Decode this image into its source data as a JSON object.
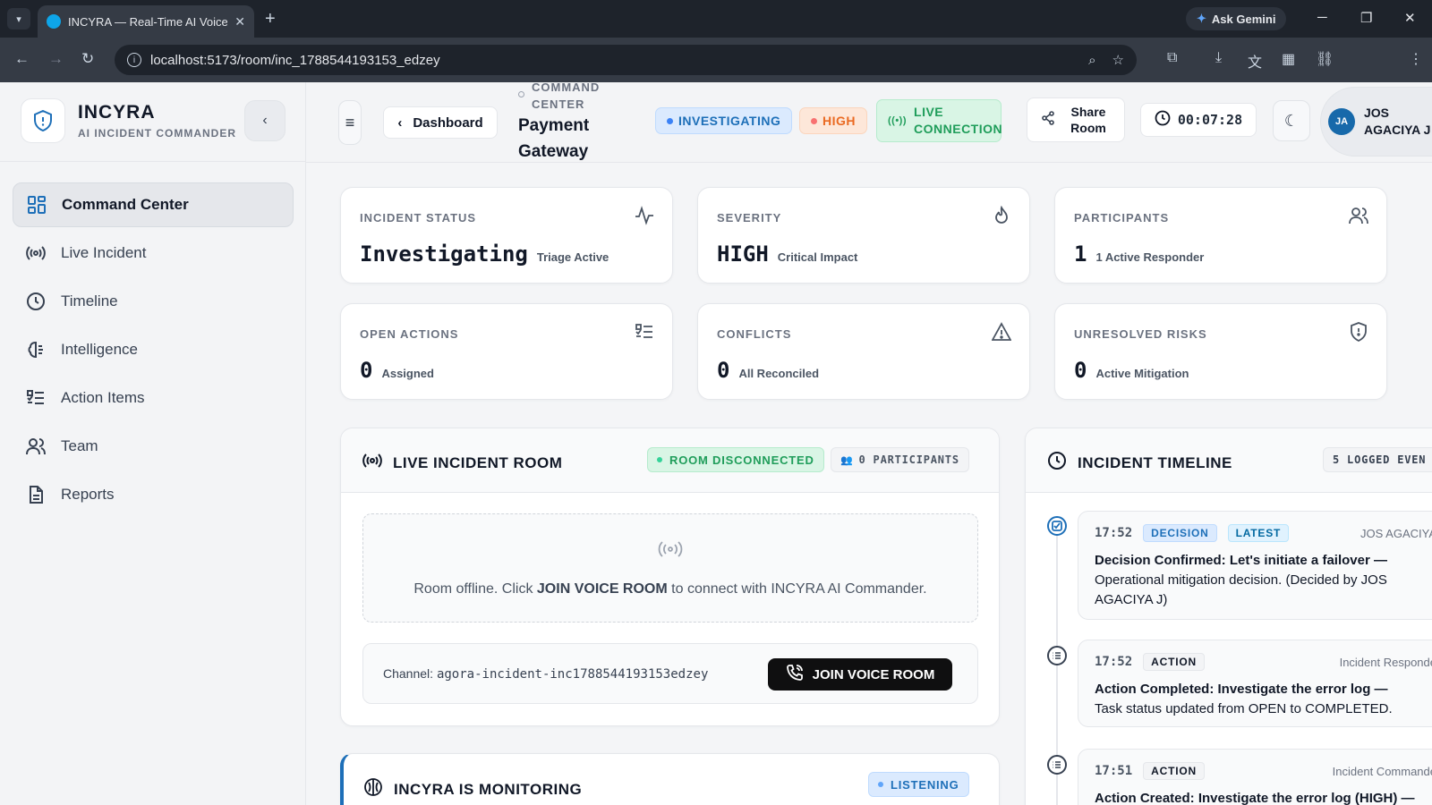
{
  "browser": {
    "tab_title": "INCYRA — Real-Time AI Voice I",
    "url": "localhost:5173/room/inc_1788544193153_edzey",
    "ask_gemini": "Ask Gemini"
  },
  "sidebar": {
    "brand_name": "INCYRA",
    "brand_subtitle": "AI INCIDENT COMMANDER",
    "items": [
      {
        "label": "Command Center",
        "icon": "grid-icon"
      },
      {
        "label": "Live Incident",
        "icon": "broadcast-icon"
      },
      {
        "label": "Timeline",
        "icon": "clock-icon"
      },
      {
        "label": "Intelligence",
        "icon": "brain-icon"
      },
      {
        "label": "Action Items",
        "icon": "checklist-icon"
      },
      {
        "label": "Team",
        "icon": "users-icon"
      },
      {
        "label": "Reports",
        "icon": "document-icon"
      }
    ]
  },
  "header": {
    "back_label": "Dashboard",
    "breadcrumb": "COMMAND CENTER",
    "incident_title": "Payment Gateway",
    "status_pill": "INVESTIGATING",
    "severity_pill": "HIGH",
    "connection_pill": "LIVE CONNECTION",
    "share_label": "Share Room",
    "timer": "00:07:28",
    "user_initials": "JA",
    "user_name": "JOS AGACIYA J"
  },
  "stats": [
    {
      "label": "INCIDENT STATUS",
      "value": "Investigating",
      "sub": "Triage Active",
      "icon": "activity-icon"
    },
    {
      "label": "SEVERITY",
      "value": "HIGH",
      "sub": "Critical Impact",
      "icon": "flame-icon"
    },
    {
      "label": "PARTICIPANTS",
      "value": "1",
      "sub": "1 Active Responder",
      "icon": "users-icon"
    },
    {
      "label": "OPEN ACTIONS",
      "value": "0",
      "sub": "Assigned",
      "icon": "checklist-icon"
    },
    {
      "label": "CONFLICTS",
      "value": "0",
      "sub": "All Reconciled",
      "icon": "warning-icon"
    },
    {
      "label": "UNRESOLVED RISKS",
      "value": "0",
      "sub": "Active Mitigation",
      "icon": "shield-icon"
    }
  ],
  "room": {
    "title": "LIVE INCIDENT ROOM",
    "status": "ROOM DISCONNECTED",
    "participants": "0 PARTICIPANTS",
    "offline_pre": "Room offline. Click",
    "offline_bold": "JOIN VOICE ROOM",
    "offline_post": "to connect with INCYRA AI Commander.",
    "channel_label": "Channel:",
    "channel_id": "agora-incident-inc1788544193153edzey",
    "join_label": "JOIN VOICE ROOM"
  },
  "monitor": {
    "title": "INCYRA IS MONITORING",
    "status": "LISTENING"
  },
  "timeline": {
    "title": "INCIDENT TIMELINE",
    "count": "5 LOGGED EVEN",
    "entries": [
      {
        "time": "17:52",
        "type": "DECISION",
        "latest": "LATEST",
        "author": "JOS AGACIYA",
        "title": "Decision Confirmed: Let's initiate a failover —",
        "body": "Operational mitigation decision. (Decided by JOS AGACIYA J)"
      },
      {
        "time": "17:52",
        "type": "ACTION",
        "author": "Incident Responde",
        "title": "Action Completed: Investigate the error log —",
        "body": "Task status updated from OPEN to COMPLETED."
      },
      {
        "time": "17:51",
        "type": "ACTION",
        "author": "Incident Commande",
        "title": "Action Created: Investigate the error log (HIGH) —",
        "body": ""
      }
    ]
  },
  "colors": {
    "accent_blue": "#1d6fb8",
    "high_orange": "#ea6a22",
    "live_green": "#1f9d5a"
  }
}
